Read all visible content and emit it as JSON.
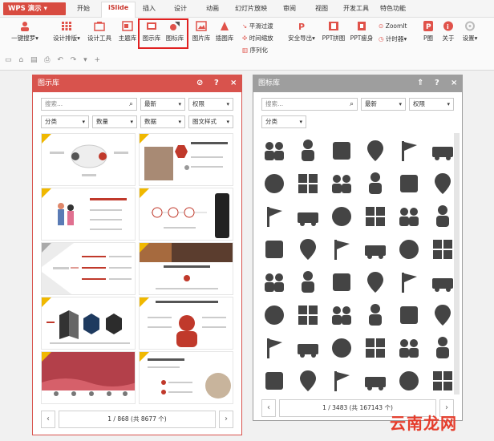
{
  "app": {
    "title": "WPS 演示"
  },
  "tabs": [
    {
      "label": "开始"
    },
    {
      "label": "iSlide"
    },
    {
      "label": "插入"
    },
    {
      "label": "设计"
    },
    {
      "label": "动画"
    },
    {
      "label": "幻灯片放映"
    },
    {
      "label": "审阅"
    },
    {
      "label": "视图"
    },
    {
      "label": "开发工具"
    },
    {
      "label": "特色功能"
    }
  ],
  "ribbon": {
    "one_click": "一键搜罗",
    "design_layout": "设计排版",
    "design_tools": "设计工具",
    "theme_lib": "主题库",
    "diagram_lib": "图示库",
    "icon_lib": "图标库",
    "image_lib": "图片库",
    "illustration_lib": "插图库",
    "smooth_transition": "平滑过渡",
    "time_zoom": "时间缩放",
    "sequence": "序列化",
    "safe_export": "安全导出",
    "ppt_tile": "PPT拼图",
    "ppt_slim": "PPT瘦身",
    "zoomit": "ZoomIt",
    "timer": "计时器",
    "pdraw": "P圈",
    "about": "关于",
    "settings": "设置"
  },
  "colors": {
    "diagram_header": "#d8534d",
    "icon_header": "#9e9e9e",
    "accent": "#c8332a",
    "highlight": "#e02020",
    "watermark": "#e53c2b"
  },
  "diagram_panel": {
    "title": "图示库",
    "search_placeholder": "搜索...",
    "sort": "最新",
    "permission": "权限",
    "category": "分类",
    "quantity": "数量",
    "data": "数据",
    "style": "图文样式",
    "pager": "1 / 868 (共 8677 个)"
  },
  "icon_panel": {
    "title": "图标库",
    "search_placeholder": "搜索...",
    "sort": "最新",
    "permission": "权限",
    "category": "分类",
    "pager": "1 / 3483 (共 167143 个)",
    "icons": [
      "meeting-icon",
      "team-icon",
      "person-network-icon",
      "location-pin-icon",
      "flag-icon",
      "ambulance-icon",
      "user-settings-icon",
      "org-chart-icon",
      "group-icon",
      "elevator-icon",
      "house-icon",
      "mail-person-icon",
      "user-upload-icon",
      "bicycle-icon",
      "brick-wall-icon",
      "hand-wave-icon",
      "support-agent-icon",
      "face-glasses-icon",
      "document-list-icon",
      "person-stand-icon",
      "camera-icon",
      "globe-icon",
      "family-icon",
      "headphones-icon",
      "gear-circle-icon",
      "podium-icon",
      "desk-icon",
      "brain-head-icon",
      "award-group-icon",
      "database-settings-icon",
      "exit-door-icon",
      "pair-icon",
      "couple-icon",
      "fan-icon",
      "flag-pole-icon",
      "dog-icon",
      "swimmer-icon",
      "bus-icon",
      "person-box-icon",
      "handshake-icon",
      "air-conditioner-icon",
      "bomb-icon",
      "up-arrows-icon",
      "documents-icon",
      "medal-icon",
      "qr-code-icon",
      "chart-board-icon",
      "audience-icon"
    ]
  },
  "watermark": "云南龙网"
}
